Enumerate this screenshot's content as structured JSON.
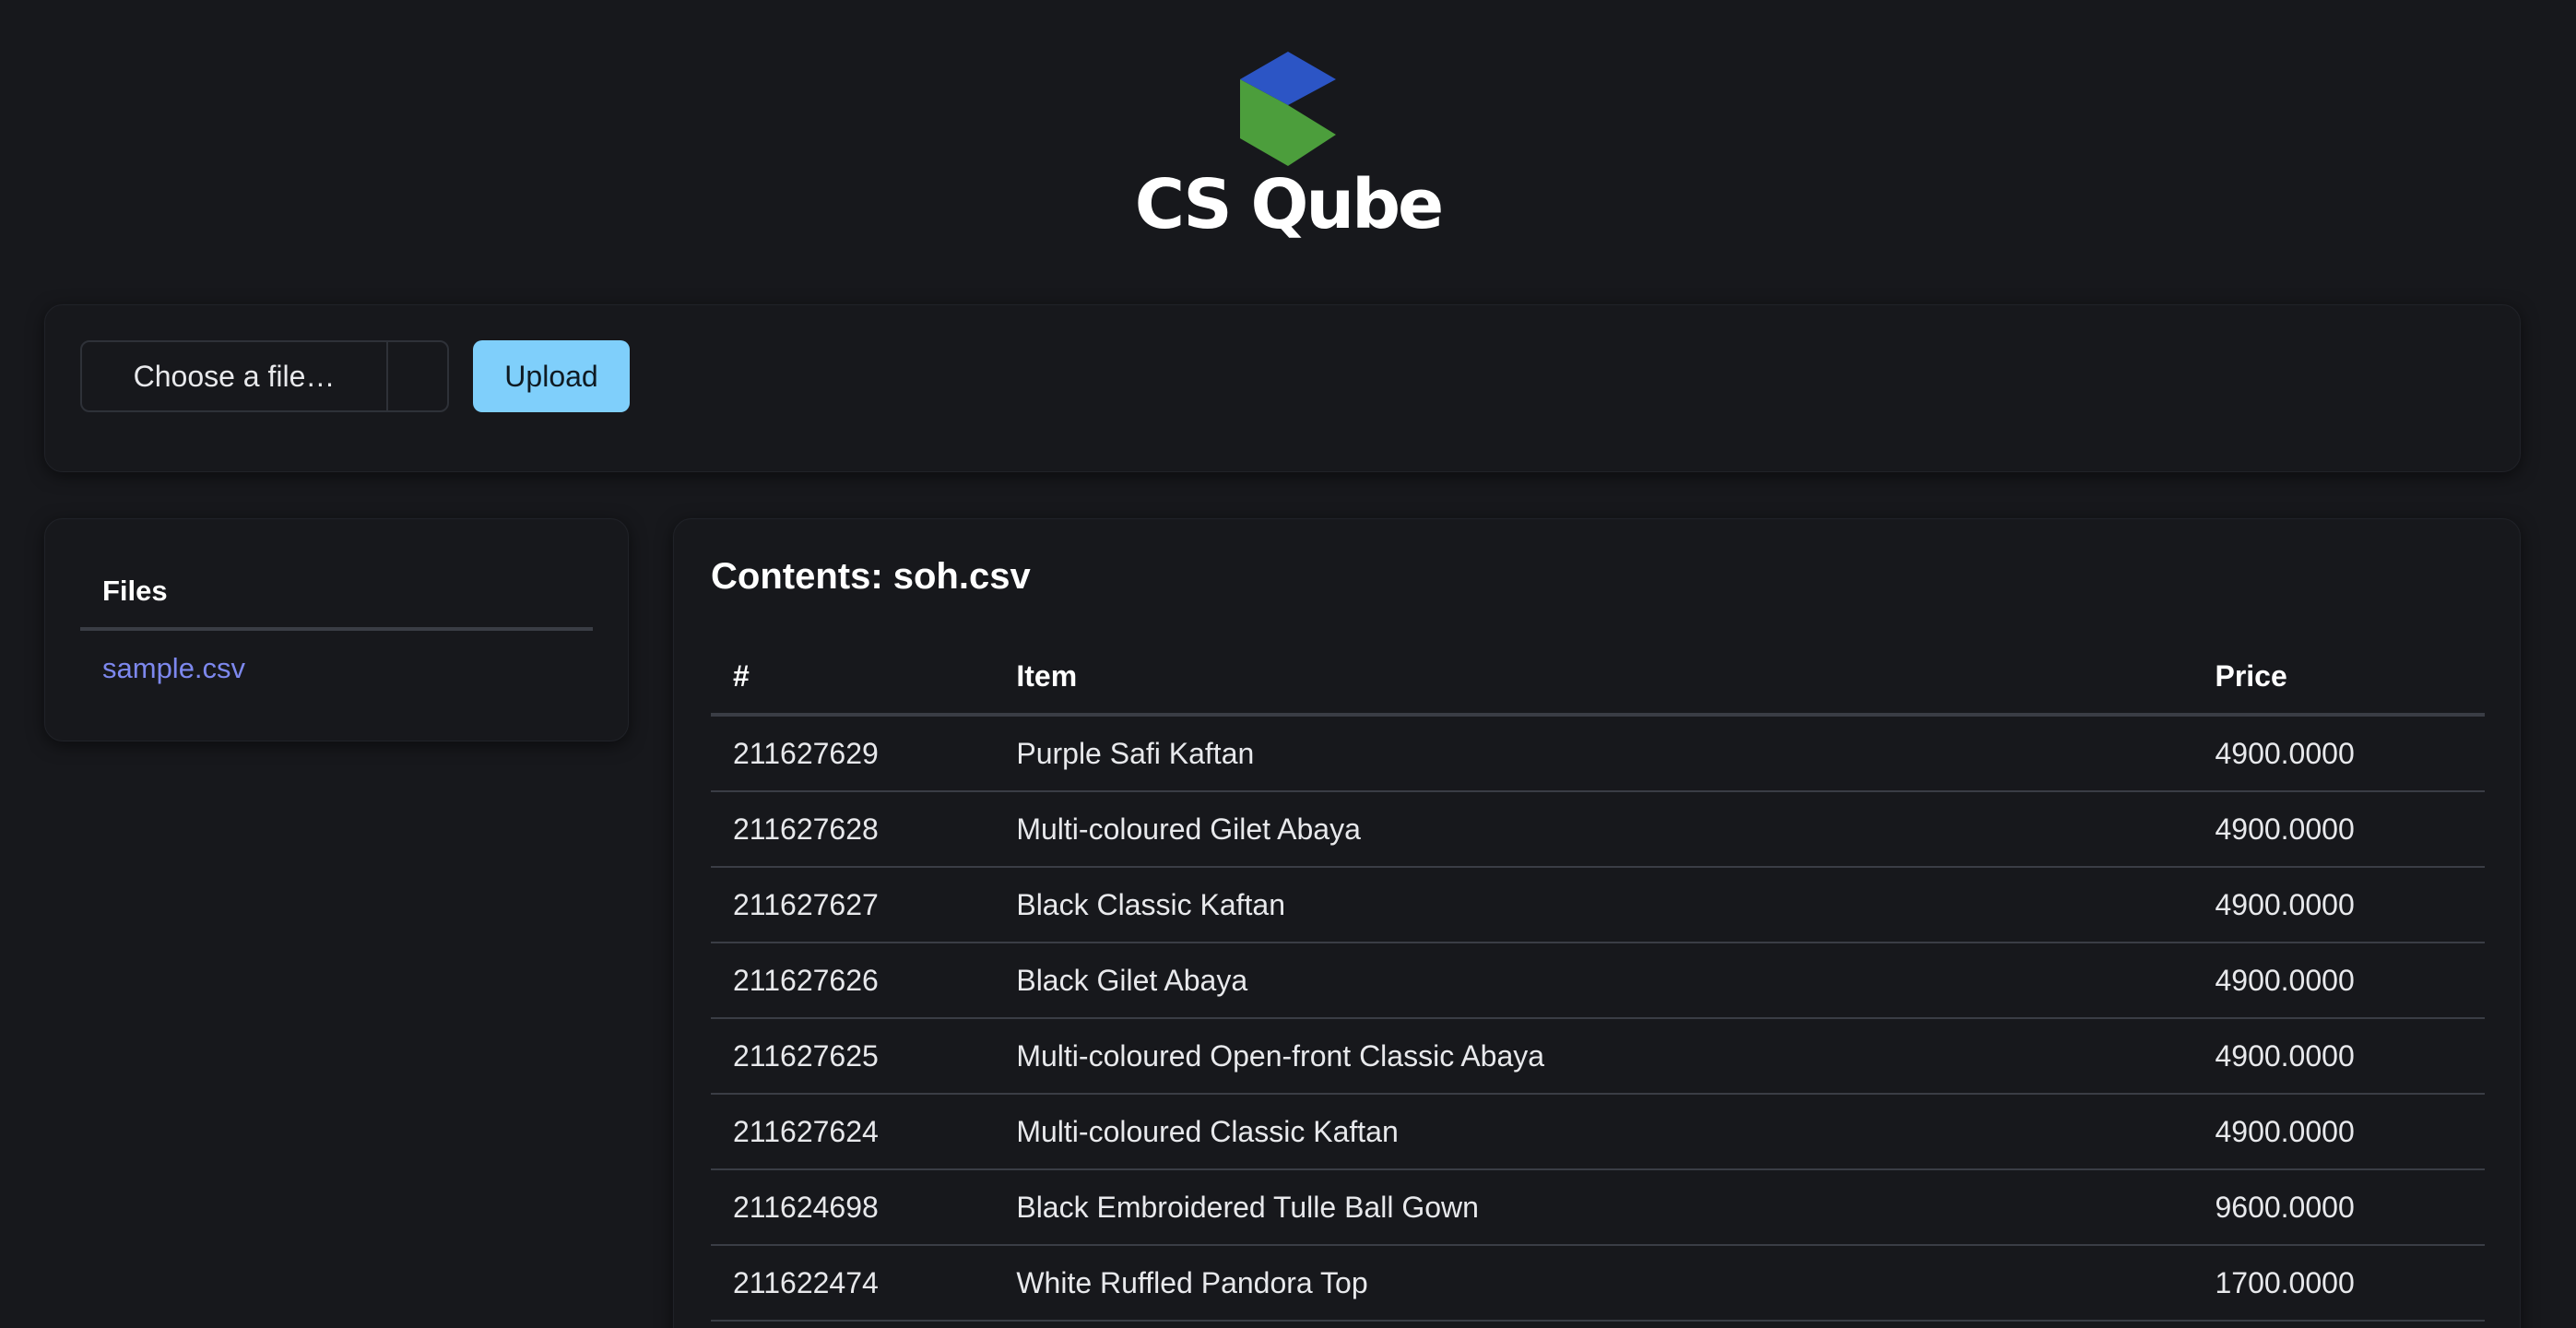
{
  "brand": {
    "name": "CS Qube",
    "colors": {
      "top": "#2c55c5",
      "bottom": "#4c9e3c"
    }
  },
  "upload": {
    "choose_label": "Choose a file…",
    "upload_label": "Upload"
  },
  "files": {
    "title": "Files",
    "items": [
      {
        "name": "sample.csv"
      }
    ]
  },
  "contents": {
    "title": "Contents: soh.csv",
    "columns": [
      "#",
      "Item",
      "Price"
    ],
    "rows": [
      [
        "211627629",
        "Purple Safi Kaftan",
        "4900.0000"
      ],
      [
        "211627628",
        "Multi-coloured Gilet Abaya",
        "4900.0000"
      ],
      [
        "211627627",
        "Black Classic Kaftan",
        "4900.0000"
      ],
      [
        "211627626",
        "Black Gilet Abaya",
        "4900.0000"
      ],
      [
        "211627625",
        "Multi-coloured Open-front Classic Abaya",
        "4900.0000"
      ],
      [
        "211627624",
        "Multi-coloured Classic Kaftan",
        "4900.0000"
      ],
      [
        "211624698",
        "Black Embroidered Tulle Ball Gown",
        "9600.0000"
      ],
      [
        "211622474",
        "White Ruffled Pandora Top",
        "1700.0000"
      ]
    ]
  }
}
